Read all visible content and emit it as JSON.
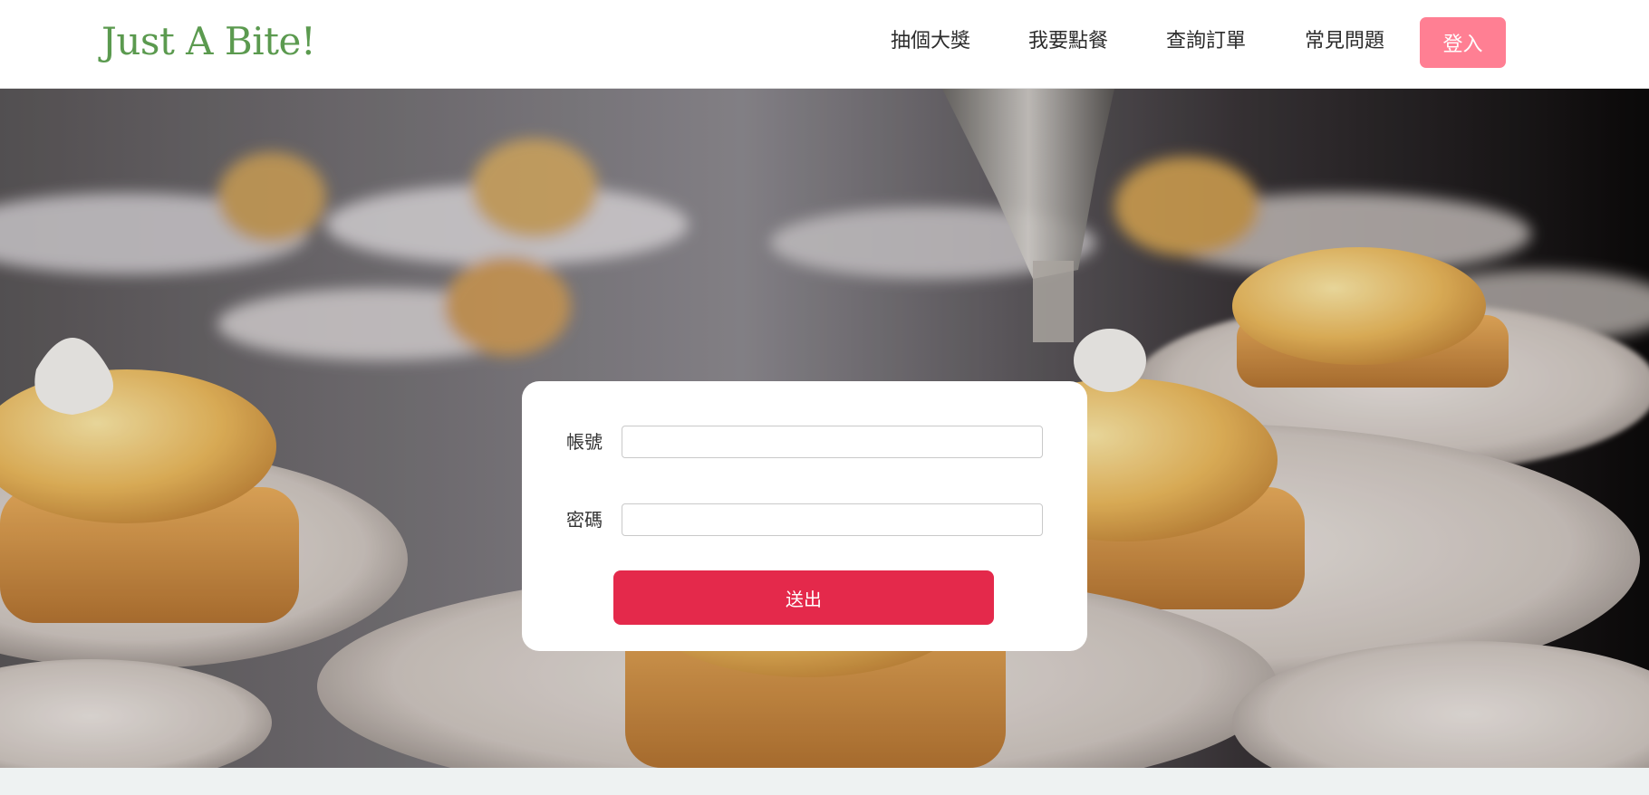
{
  "header": {
    "brand": "Just A Bite!",
    "nav": {
      "lottery": "抽個大獎",
      "order": "我要點餐",
      "query": "查詢訂單",
      "faq": "常見問題"
    },
    "login_label": "登入"
  },
  "login_form": {
    "account_label": "帳號",
    "account_value": "",
    "password_label": "密碼",
    "password_value": "",
    "submit_label": "送出"
  },
  "colors": {
    "brand": "#5b9a4f",
    "login_button": "#ff7f93",
    "submit_button": "#e4294b"
  }
}
